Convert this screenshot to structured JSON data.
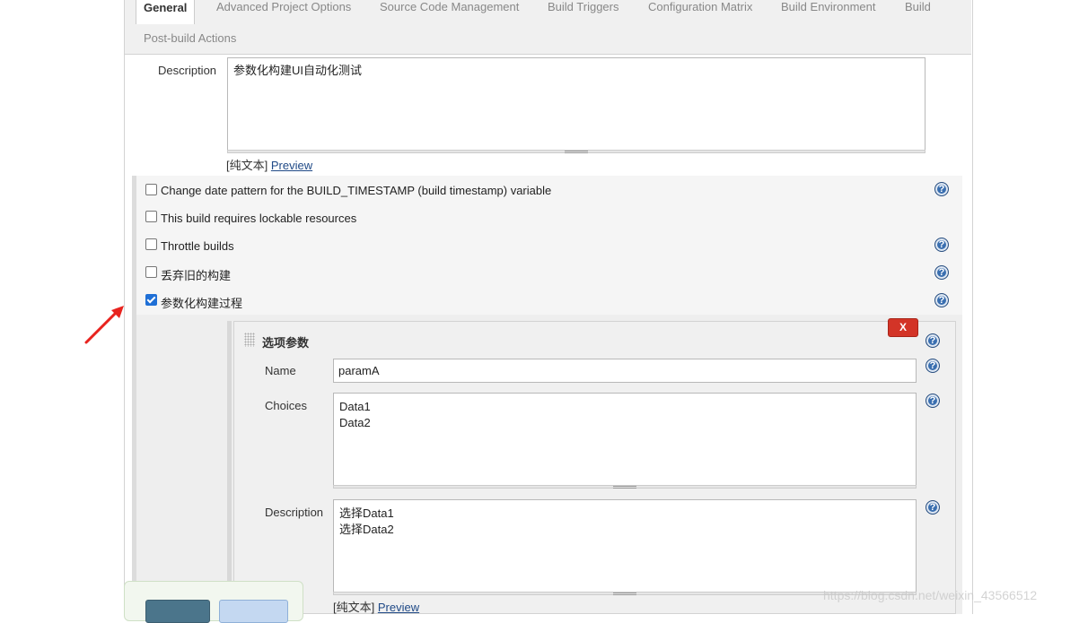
{
  "tabs": [
    {
      "label": "General"
    },
    {
      "label": "Advanced Project Options"
    },
    {
      "label": "Source Code Management"
    },
    {
      "label": "Build Triggers"
    },
    {
      "label": "Configuration Matrix"
    },
    {
      "label": "Build Environment"
    },
    {
      "label": "Build"
    },
    {
      "label": "Post-build Actions"
    }
  ],
  "description": {
    "label": "Description",
    "value": "参数化构建UI自动化测试",
    "plain_text": "[纯文本]",
    "preview": "Preview"
  },
  "options": [
    {
      "label": "Change date pattern for the BUILD_TIMESTAMP (build timestamp) variable",
      "checked": false,
      "help": true
    },
    {
      "label": "This build requires lockable resources",
      "checked": false,
      "help": false
    },
    {
      "label": "Throttle builds",
      "checked": false,
      "help": true
    },
    {
      "label": "丢弃旧的构建",
      "checked": false,
      "help": true
    },
    {
      "label": "参数化构建过程",
      "checked": true,
      "help": true
    }
  ],
  "parameter": {
    "title": "选项参数",
    "delete_label": "X",
    "name_label": "Name",
    "name_value": "paramA",
    "choices_label": "Choices",
    "choices_value": "Data1\nData2",
    "description_label": "Description",
    "description_value": "选择Data1\n选择Data2",
    "plain_text": "[纯文本]",
    "preview": "Preview"
  },
  "watermark": "https://blog.csdn.net/weixin_43566512",
  "help_glyph": "?"
}
